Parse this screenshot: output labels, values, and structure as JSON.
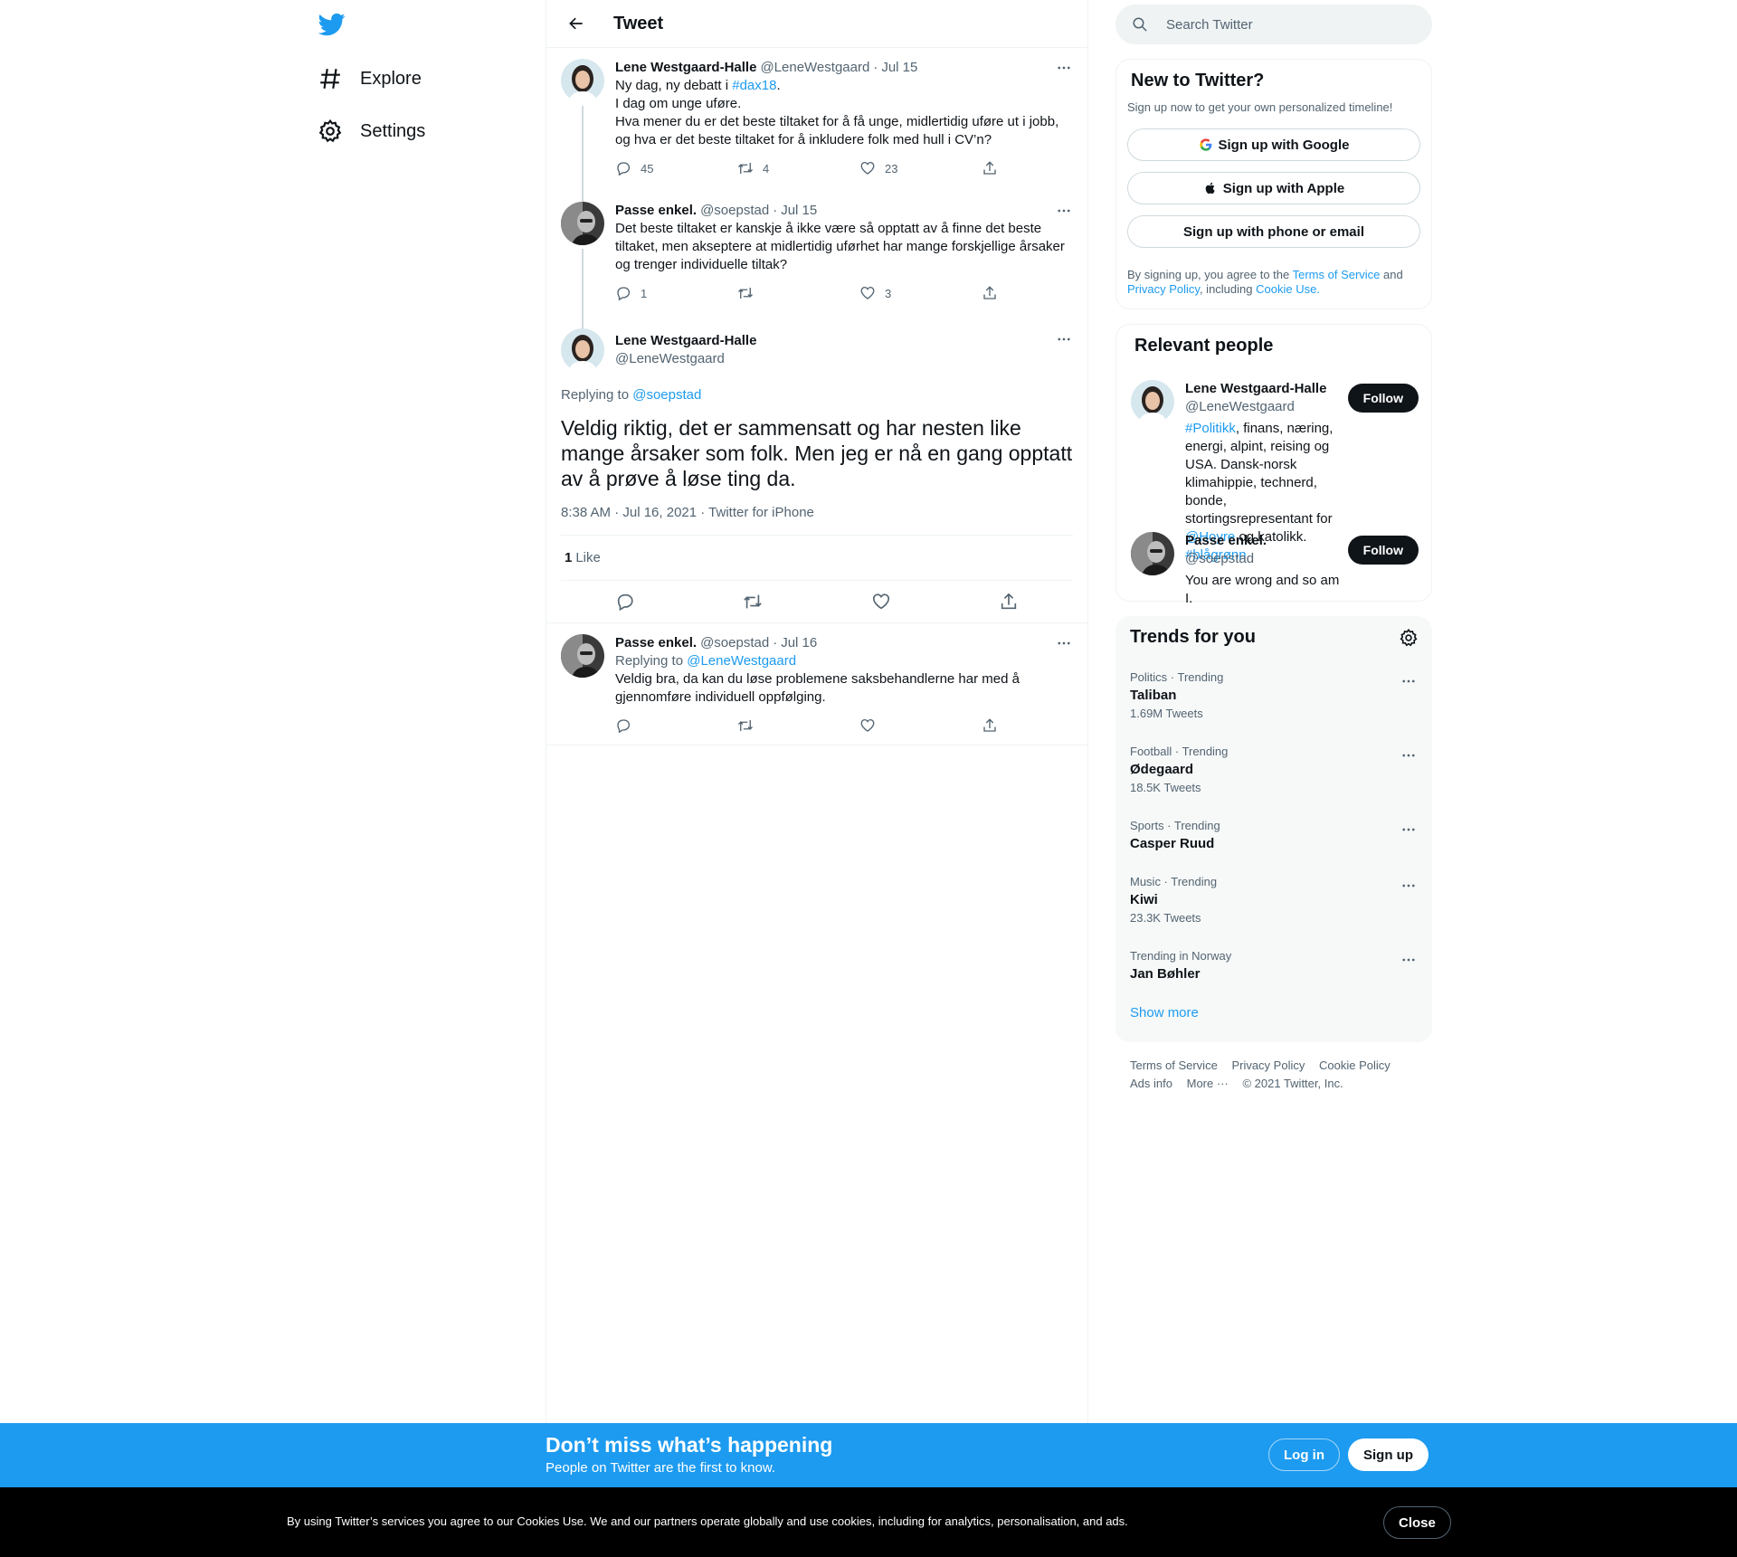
{
  "colors": {
    "accent": "#1d9bf0",
    "text": "#0f1419",
    "secondary": "#536471",
    "banner": "#1d9bf0"
  },
  "nav": {
    "logo_icon": "twitter-bird-icon",
    "items": [
      {
        "label": "Explore",
        "icon": "hashtag-icon"
      },
      {
        "label": "Settings",
        "icon": "gear-icon"
      }
    ]
  },
  "header": {
    "title": "Tweet"
  },
  "thread": [
    {
      "name": "Lene Westgaard-Halle",
      "handle": "@LeneWestgaard",
      "date": "Jul 15",
      "text_pre": "Ny dag, ny debatt i ",
      "hashtag": "#dax18",
      "text_post": ".\nI dag om unge uføre.\nHva mener du er det beste tiltaket for å få unge, midlertidig uføre ut i jobb, og hva er det beste tiltaket for å inkludere folk med hull i CV’n?",
      "replies": "45",
      "retweets": "4",
      "likes": "23"
    },
    {
      "name": "Passe enkel.",
      "handle": "@soepstad",
      "date": "Jul 15",
      "text": "Det beste tiltaket er kanskje å ikke være så opptatt av å finne det beste tiltaket, men akseptere at midlertidig uførhet har mange forskjellige årsaker og trenger individuelle tiltak?",
      "replies": "1",
      "retweets": "",
      "likes": "3"
    }
  ],
  "focus": {
    "name": "Lene Westgaard-Halle",
    "handle": "@LeneWestgaard",
    "replying_label": "Replying to",
    "replying_to": "@soepstad",
    "text": "Veldig riktig, det er sammensatt og har nesten like mange årsaker som folk. Men jeg er nå en gang opptatt av å prøve å løse ting da.",
    "meta": "8:38 AM · Jul 16, 2021 · Twitter for iPhone",
    "like_count": "1",
    "like_label": "Like"
  },
  "reply": {
    "name": "Passe enkel.",
    "handle": "@soepstad",
    "date": "Jul 16",
    "replying_label": "Replying to",
    "replying_to": "@LeneWestgaard",
    "text": "Veldig bra, da kan du løse problemene saksbehandlerne har med å gjennomføre individuell oppfølging."
  },
  "search": {
    "placeholder": "Search Twitter"
  },
  "new_to_twitter": {
    "title": "New to Twitter?",
    "subtitle": "Sign up now to get your own personalized timeline!",
    "google": "Sign up with Google",
    "apple": "Sign up with Apple",
    "phone": "Sign up with phone or email",
    "legal_1": "By signing up, you agree to the ",
    "terms": "Terms of Service",
    "legal_2": " and ",
    "privacy": "Privacy Policy",
    "legal_3": ", including ",
    "cookie": "Cookie Use."
  },
  "relevant": {
    "title": "Relevant people",
    "follow_label": "Follow",
    "people": [
      {
        "name": "Lene Westgaard-Halle",
        "handle": "@LeneWestgaard",
        "bio_tag1": "#Politikk",
        "bio_1": ", finans, næring, energi, alpint, reising og USA. Dansk-norsk klimahippie, technerd, bonde, stortingsrepresentant for ",
        "bio_tag2": "@Hoyre",
        "bio_2": " og katolikk. ",
        "bio_tag3": "#blågrønn"
      },
      {
        "name": "Passe enkel.",
        "handle": "@soepstad",
        "bio": "You are wrong and so am I."
      }
    ]
  },
  "trends": {
    "title": "Trends for you",
    "items": [
      {
        "meta": "Politics · Trending",
        "name": "Taliban",
        "count": "1.69M Tweets"
      },
      {
        "meta": "Football · Trending",
        "name": "Ødegaard",
        "count": "18.5K Tweets"
      },
      {
        "meta": "Sports · Trending",
        "name": "Casper Ruud",
        "count": ""
      },
      {
        "meta": "Music · Trending",
        "name": "Kiwi",
        "count": "23.3K Tweets"
      },
      {
        "meta": "Trending in Norway",
        "name": "Jan Bøhler",
        "count": ""
      }
    ],
    "show_more": "Show more"
  },
  "footer": {
    "links": [
      "Terms of Service",
      "Privacy Policy",
      "Cookie Policy",
      "Ads info",
      "More ···"
    ],
    "copyright": "© 2021 Twitter, Inc."
  },
  "banner": {
    "title": "Don’t miss what’s happening",
    "subtitle": "People on Twitter are the first to know.",
    "login": "Log in",
    "signup": "Sign up"
  },
  "cookie": {
    "text": "By using Twitter’s services you agree to our Cookies Use. We and our partners operate globally and use cookies, including for analytics, personalisation, and ads.",
    "close": "Close"
  }
}
